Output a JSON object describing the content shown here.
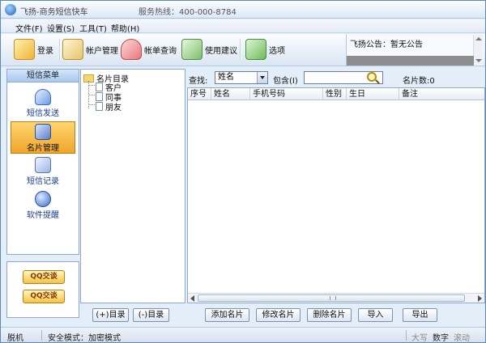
{
  "window": {
    "title": "飞扬-商务短信快车",
    "hotline": "服务热线：400-000-8784"
  },
  "menu": [
    "文件(F)",
    "设置(S)",
    "工具(T)",
    "帮助(H)"
  ],
  "toolbar": {
    "buttons": [
      {
        "label": "登录",
        "icon": "login-icon"
      },
      {
        "label": "帐户管理",
        "icon": "account-icon"
      },
      {
        "label": "帐单查询",
        "icon": "bill-icon"
      },
      {
        "label": "使用建议",
        "icon": "suggestion-icon"
      },
      {
        "label": "选项",
        "icon": "options-icon"
      }
    ],
    "notice": "飞扬公告：暂无公告"
  },
  "sidebar": {
    "header": "短信菜单",
    "items": [
      {
        "label": "短信发送",
        "icon": "sms-send-icon",
        "active": false
      },
      {
        "label": "名片管理",
        "icon": "card-manage-icon",
        "active": true
      },
      {
        "label": "短信记录",
        "icon": "sms-log-icon",
        "active": false
      },
      {
        "label": "软件提醒",
        "icon": "reminder-icon",
        "active": false
      }
    ],
    "qq_buttons": [
      "QQ交谈",
      "QQ交谈"
    ]
  },
  "tree": {
    "root": "名片目录",
    "children": [
      "客户",
      "同事",
      "朋友"
    ]
  },
  "search": {
    "find_label": "查找:",
    "field_value": "姓名",
    "contains_label": "包含(I)",
    "input_value": "",
    "count_label": "名片数:0"
  },
  "table": {
    "columns": [
      "序号",
      "姓名",
      "手机号码",
      "性别",
      "生日",
      "备注"
    ]
  },
  "buttons": {
    "add_dir": "(+)目录",
    "remove_dir": "(-)目录",
    "add_card": "添加名片",
    "edit_card": "修改名片",
    "delete_card": "删除名片",
    "import": "导入",
    "export": "导出"
  },
  "status": {
    "connection": "脱机",
    "security": "安全模式：加密模式",
    "caps": "大写",
    "num": "数字",
    "scroll": "滚动"
  }
}
